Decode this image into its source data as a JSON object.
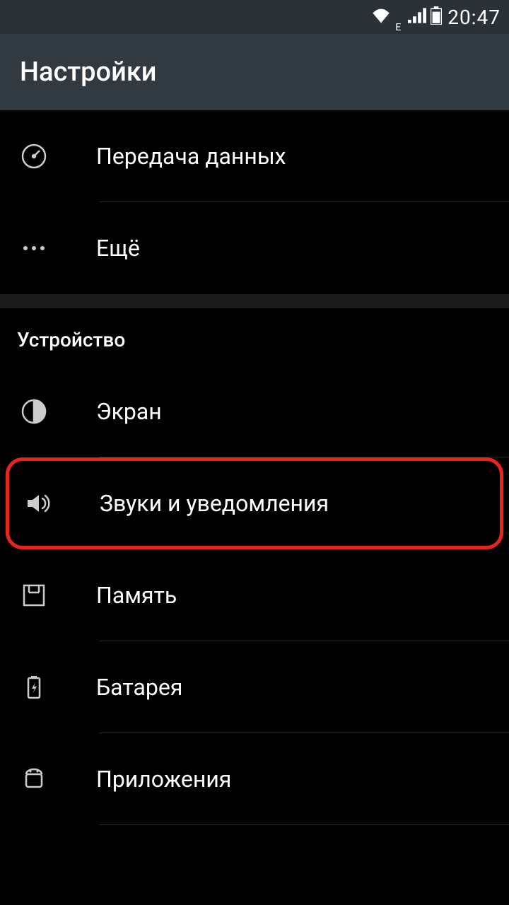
{
  "status": {
    "time": "20:47",
    "network_sub": "E"
  },
  "appbar": {
    "title": "Настройки"
  },
  "items": {
    "data_usage": "Передача данных",
    "more": "Ещё",
    "display": "Экран",
    "sound": "Звуки и уведомления",
    "storage": "Память",
    "battery": "Батарея",
    "apps": "Приложения"
  },
  "sections": {
    "device": "Устройство"
  }
}
